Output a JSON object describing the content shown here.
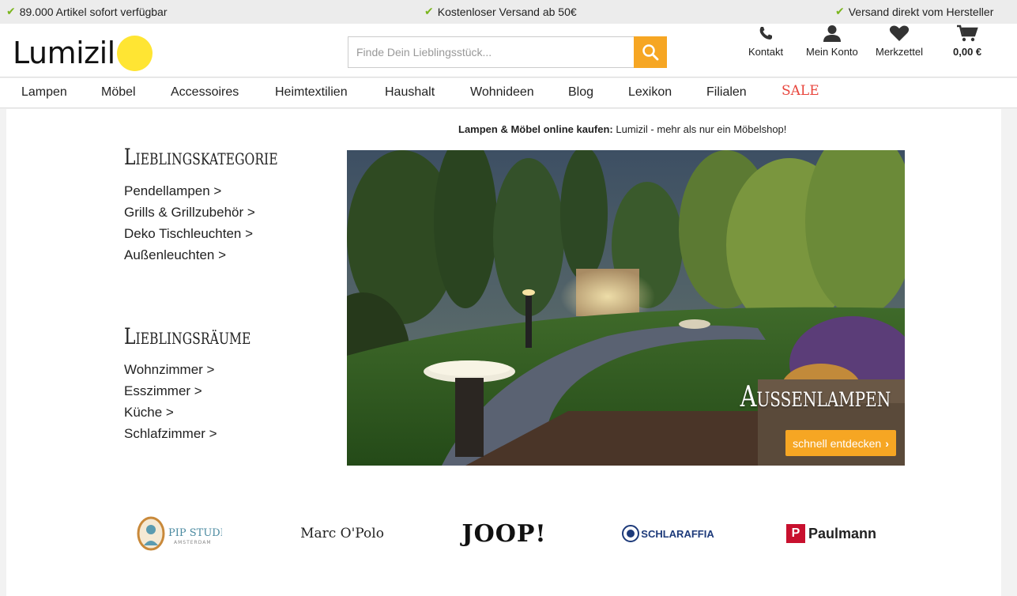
{
  "topbar": {
    "usp1": "89.000 Artikel sofort verfügbar",
    "usp2": "Kostenloser Versand ab 50€",
    "usp3": "Versand direkt vom Hersteller"
  },
  "header": {
    "logo_text": "Lumizil",
    "search_placeholder": "Finde Dein Lieblingsstück...",
    "icons": {
      "kontakt": "Kontakt",
      "konto": "Mein Konto",
      "merkzettel": "Merkzettel",
      "cart": "0,00 €"
    }
  },
  "nav": {
    "items": [
      "Lampen",
      "Möbel",
      "Accessoires",
      "Heimtextilien",
      "Haushalt",
      "Wohnideen",
      "Blog",
      "Lexikon",
      "Filialen"
    ],
    "sale": "SALE"
  },
  "main": {
    "tagline_bold": "Lampen & Möbel online kaufen:",
    "tagline_rest": " Lumizil - mehr als nur ein Möbelshop!",
    "kategorie_title": "Lieblingskategorie",
    "kategorie_links": [
      "Pendellampen >",
      "Grills & Grillzubehör >",
      "Deko Tischleuchten >",
      "Außenleuchten >"
    ],
    "raeume_title": "Lieblingsräume",
    "raeume_links": [
      "Wohnzimmer >",
      "Esszimmer >",
      "Küche >",
      "Schlafzimmer >"
    ],
    "hero_title": "Außenlampen",
    "hero_button": "schnell entdecken"
  },
  "brands": {
    "pip": "PIP STUDIO",
    "pip_sub": "AMSTERDAM",
    "marc": "Marc O'Polo",
    "joop": "JOOP!",
    "schlaraffia": "SCHLARAFFIA",
    "paulmann": "Paulmann"
  },
  "colors": {
    "accent": "#f6a623",
    "logo_dot": "#ffe533",
    "check": "#7ab51d",
    "sale": "#e8453c"
  }
}
